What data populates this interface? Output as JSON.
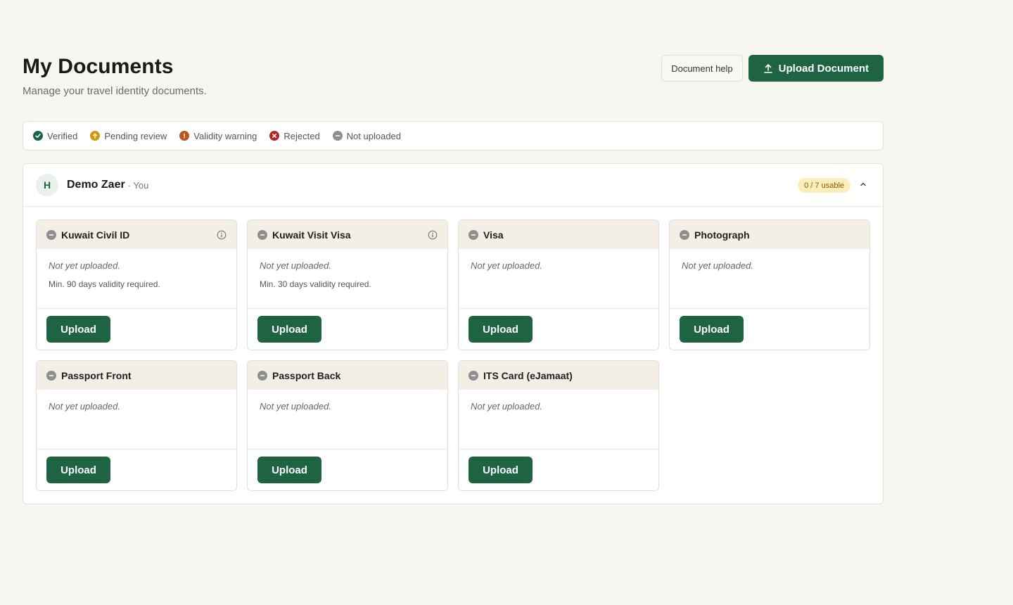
{
  "header": {
    "title": "My Documents",
    "subtitle": "Manage your travel identity documents.",
    "help_label": "Document help",
    "upload_label": "Upload Document"
  },
  "legend": [
    {
      "label": "Verified",
      "color": "#1e6442",
      "icon": "check-icon"
    },
    {
      "label": "Pending review",
      "color": "#d4970d",
      "icon": "arrow-up-icon"
    },
    {
      "label": "Validity warning",
      "color": "#b8591a",
      "icon": "exclamation-icon"
    },
    {
      "label": "Rejected",
      "color": "#b52525",
      "icon": "x-icon"
    },
    {
      "label": "Not uploaded",
      "color": "#8f8f8f",
      "icon": "minus-icon"
    }
  ],
  "member": {
    "initial": "H",
    "name": "Demo Zaer",
    "tag": "· You",
    "usable": "0 / 7 usable"
  },
  "documents": [
    {
      "title": "Kuwait Civil ID",
      "status": "Not yet uploaded.",
      "requirement": "Min. 90 days validity required.",
      "has_info": true,
      "button": "Upload"
    },
    {
      "title": "Kuwait Visit Visa",
      "status": "Not yet uploaded.",
      "requirement": "Min. 30 days validity required.",
      "has_info": true,
      "button": "Upload"
    },
    {
      "title": "Visa",
      "status": "Not yet uploaded.",
      "requirement": "",
      "has_info": false,
      "button": "Upload"
    },
    {
      "title": "Photograph",
      "status": "Not yet uploaded.",
      "requirement": "",
      "has_info": false,
      "button": "Upload"
    },
    {
      "title": "Passport Front",
      "status": "Not yet uploaded.",
      "requirement": "",
      "has_info": false,
      "button": "Upload"
    },
    {
      "title": "Passport Back",
      "status": "Not yet uploaded.",
      "requirement": "",
      "has_info": false,
      "button": "Upload"
    },
    {
      "title": "ITS Card (eJamaat)",
      "status": "Not yet uploaded.",
      "requirement": "",
      "has_info": false,
      "button": "Upload"
    }
  ],
  "colors": {
    "accent": "#1e6442",
    "not_uploaded": "#8f8f8f",
    "badge_bg": "#fbeebb"
  }
}
